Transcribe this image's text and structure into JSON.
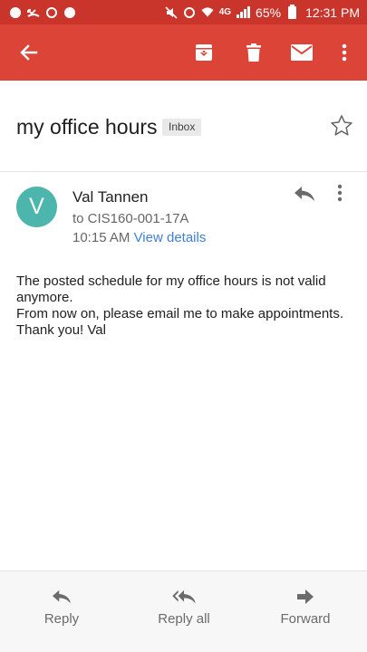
{
  "status_bar": {
    "battery": "65%",
    "time": "12:31 PM",
    "network": "4G"
  },
  "app_bar": {
    "back_icon": "arrow-back-icon",
    "archive_icon": "archive-icon",
    "delete_icon": "trash-icon",
    "mark_unread_icon": "mail-icon",
    "more_icon": "more-vert-icon",
    "color": "#db4437"
  },
  "email": {
    "subject": "my office hours",
    "label": "Inbox",
    "sender": {
      "initial": "V",
      "name": "Val Tannen",
      "avatar_color": "#4db6ac"
    },
    "recipient": "to CIS160-001-17A",
    "time": "10:15 AM",
    "view_details": "View details",
    "body": [
      "The posted schedule for my office hours is not valid anymore.",
      "From now on, please email me to make appointments.",
      "Thank you! Val"
    ]
  },
  "actions": {
    "reply": "Reply",
    "reply_all": "Reply all",
    "forward": "Forward"
  }
}
